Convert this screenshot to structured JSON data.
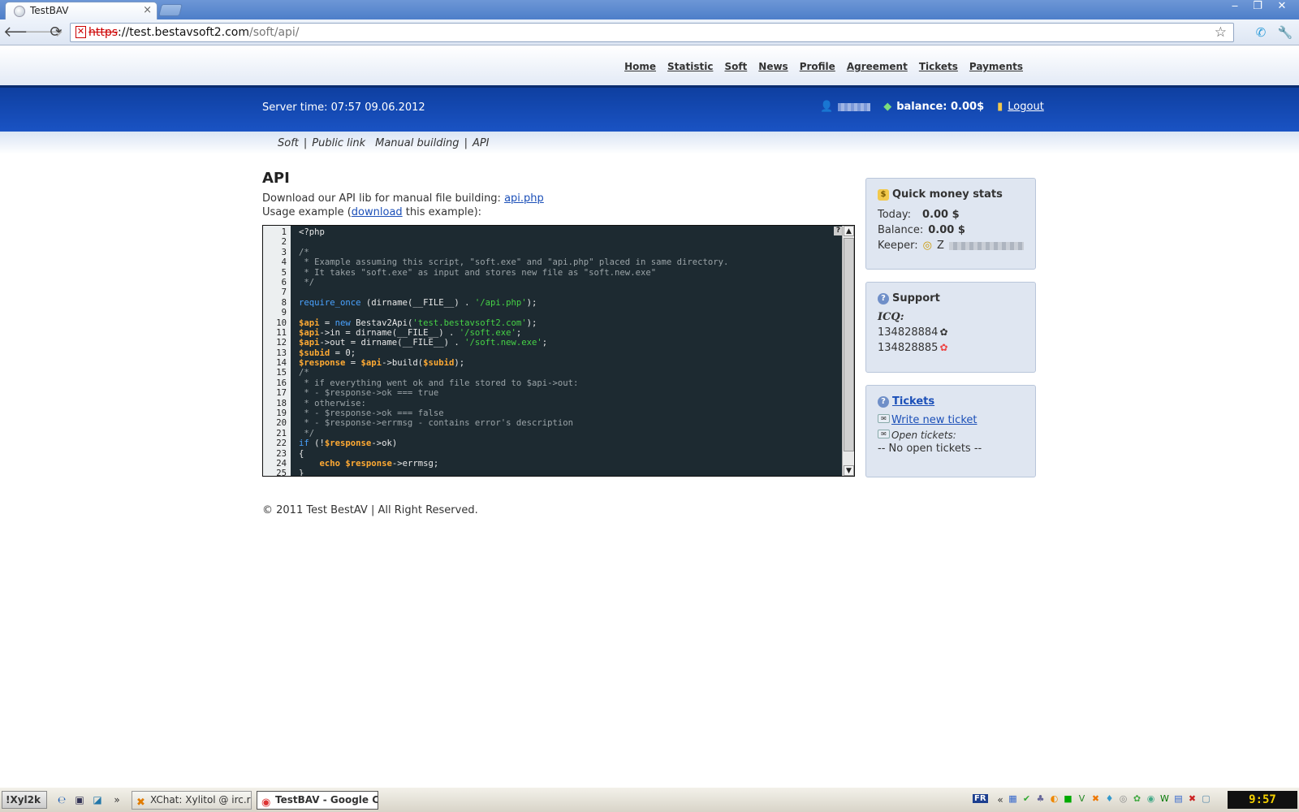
{
  "browser": {
    "tab_title": "TestBAV",
    "tab_close": "×",
    "url_protocol": "https",
    "url_host": "://test.bestavsoft2.com",
    "url_path": "/soft/api/",
    "back_glyph": "🡐",
    "forward_glyph": "🡒",
    "reload_glyph": "⟳",
    "star_glyph": "☆",
    "window_controls": [
      "‒",
      "❐",
      "✕"
    ]
  },
  "site": {
    "menu": [
      "Home",
      "Statistic",
      "Soft",
      "News",
      "Profile",
      "Agreement",
      "Tickets",
      "Payments"
    ],
    "server_time": "Server time: 07:57 09.06.2012",
    "balance": "balance: 0.00$",
    "logout": "Logout",
    "subnav": [
      "Soft",
      "Public link",
      "Manual building",
      "API"
    ],
    "heading": "API",
    "download_text": "Download our API lib for manual file building:",
    "download_link": "api.php",
    "usage_prefix": "Usage example (",
    "usage_link": "download",
    "usage_suffix": " this example):",
    "footer": "© 2011 Test BestAV | All Right Reserved."
  },
  "code_lines": [
    [
      [
        "plain",
        "<?php"
      ]
    ],
    [],
    [
      [
        "cm",
        "/*"
      ]
    ],
    [
      [
        "cm",
        " * Example assuming this script, \"soft.exe\" and \"api.php\" placed in same directory."
      ]
    ],
    [
      [
        "cm",
        " * It takes \"soft.exe\" as input and stores new file as \"soft.new.exe\""
      ]
    ],
    [
      [
        "cm",
        " */"
      ]
    ],
    [],
    [
      [
        "kw",
        "require_once"
      ],
      [
        "plain",
        " (dirname(__FILE__) . "
      ],
      [
        "str",
        "'/api.php'"
      ],
      [
        "plain",
        ");"
      ]
    ],
    [],
    [
      [
        "var",
        "$api"
      ],
      [
        "plain",
        " = "
      ],
      [
        "kw",
        "new"
      ],
      [
        "plain",
        " Bestav2Api("
      ],
      [
        "str",
        "'test.bestavsoft2.com'"
      ],
      [
        "plain",
        ");"
      ]
    ],
    [
      [
        "var",
        "$api"
      ],
      [
        "plain",
        "->in = dirname(__FILE__) . "
      ],
      [
        "str",
        "'/soft.exe'"
      ],
      [
        "plain",
        ";"
      ]
    ],
    [
      [
        "var",
        "$api"
      ],
      [
        "plain",
        "->out = dirname(__FILE__) . "
      ],
      [
        "str",
        "'/soft.new.exe'"
      ],
      [
        "plain",
        ";"
      ]
    ],
    [
      [
        "var",
        "$subid"
      ],
      [
        "plain",
        " = 0;"
      ]
    ],
    [
      [
        "var",
        "$response"
      ],
      [
        "plain",
        " = "
      ],
      [
        "var",
        "$api"
      ],
      [
        "plain",
        "->build("
      ],
      [
        "var",
        "$subid"
      ],
      [
        "plain",
        ");"
      ]
    ],
    [
      [
        "cm",
        "/*"
      ]
    ],
    [
      [
        "cm",
        " * if everything went ok and file stored to $api->out:"
      ]
    ],
    [
      [
        "cm",
        " * - $response->ok === true"
      ]
    ],
    [
      [
        "cm",
        " * otherwise:"
      ]
    ],
    [
      [
        "cm",
        " * - $response->ok === false"
      ]
    ],
    [
      [
        "cm",
        " * - $response->errmsg - contains error's description"
      ]
    ],
    [
      [
        "cm",
        " */"
      ]
    ],
    [
      [
        "kw",
        "if"
      ],
      [
        "plain",
        " (!"
      ],
      [
        "var",
        "$response"
      ],
      [
        "plain",
        "->ok)"
      ]
    ],
    [
      [
        "plain",
        "{"
      ]
    ],
    [
      [
        "plain",
        "    "
      ],
      [
        "var",
        "echo"
      ],
      [
        "plain",
        " "
      ],
      [
        "var",
        "$response"
      ],
      [
        "plain",
        "->errmsg;"
      ]
    ],
    [
      [
        "plain",
        "}"
      ]
    ]
  ],
  "code_help": "?",
  "sidebar": {
    "money": {
      "title": "Quick money stats",
      "today_label": "Today:",
      "today_value": "0.00 $",
      "balance_label": "Balance:",
      "balance_value": "0.00 $",
      "keeper_label": "Keeper:",
      "keeper_prefix": "Z"
    },
    "support": {
      "title": "Support",
      "icq_label": "ICQ:",
      "icq_numbers": [
        "134828884",
        "134828885"
      ]
    },
    "tickets": {
      "title": "Tickets",
      "write_new": "Write new ticket",
      "open_label": "Open tickets:",
      "none": "-- No open tickets --"
    }
  },
  "taskbar": {
    "start": "!Xyl2k",
    "items": [
      "XChat: Xylitol @ irc.rizon...",
      "TestBAV - Google Chr..."
    ],
    "lang": "FR",
    "clock": "9:57"
  }
}
